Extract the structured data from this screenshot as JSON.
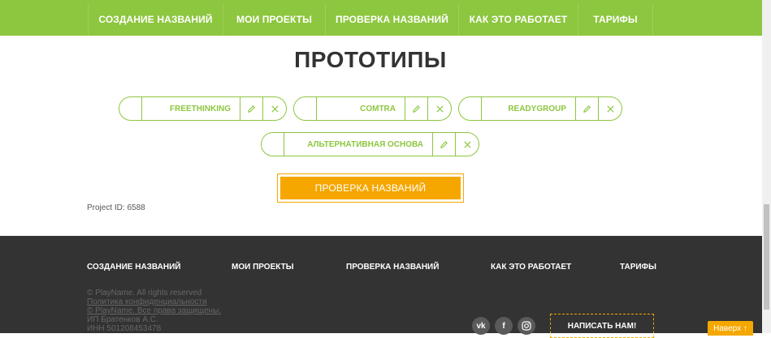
{
  "nav": {
    "items": [
      {
        "label": "СОЗДАНИЕ НАЗВАНИЙ"
      },
      {
        "label": "МОИ ПРОЕКТЫ"
      },
      {
        "label": "ПРОВЕРКА НАЗВАНИЙ"
      },
      {
        "label": "КАК ЭТО РАБОТАЕТ"
      },
      {
        "label": "ТАРИФЫ"
      }
    ]
  },
  "page": {
    "title": "ПРОТОТИПЫ",
    "prototypes": [
      {
        "name": "FREETHINKING"
      },
      {
        "name": "COMTRA"
      },
      {
        "name": "READYGROUP"
      },
      {
        "name": "АЛЬТЕРНАТИВНАЯ ОСНОВА"
      }
    ],
    "check_button": "ПРОВЕРКА НАЗВАНИЙ",
    "project_id": "Project ID: 6588"
  },
  "footer": {
    "nav": [
      {
        "label": "СОЗДАНИЕ НАЗВАНИЙ"
      },
      {
        "label": "МОИ ПРОЕКТЫ"
      },
      {
        "label": "ПРОВЕРКА НАЗВАНИЙ"
      },
      {
        "label": "КАК ЭТО РАБОТАЕТ"
      },
      {
        "label": "ТАРИФЫ"
      }
    ],
    "copyright": "© PlayName. All rights reserved",
    "privacy_link": "Политика конфиденциальности",
    "copyright_ru": "© PlayName. Все права защищены.",
    "owner": "ИП Братенков А.С.",
    "inn": "ИНН 501208453478",
    "social": [
      {
        "icon": "vk-icon",
        "glyph": "vk"
      },
      {
        "icon": "facebook-icon",
        "glyph": "f"
      },
      {
        "icon": "instagram-icon",
        "glyph": ""
      }
    ],
    "write_button": "НАПИСАТЬ НАМ!",
    "up_button": "Наверх ↑"
  },
  "colors": {
    "accent_green": "#8dc63f",
    "accent_orange": "#f5a700",
    "footer_bg": "#333333"
  }
}
